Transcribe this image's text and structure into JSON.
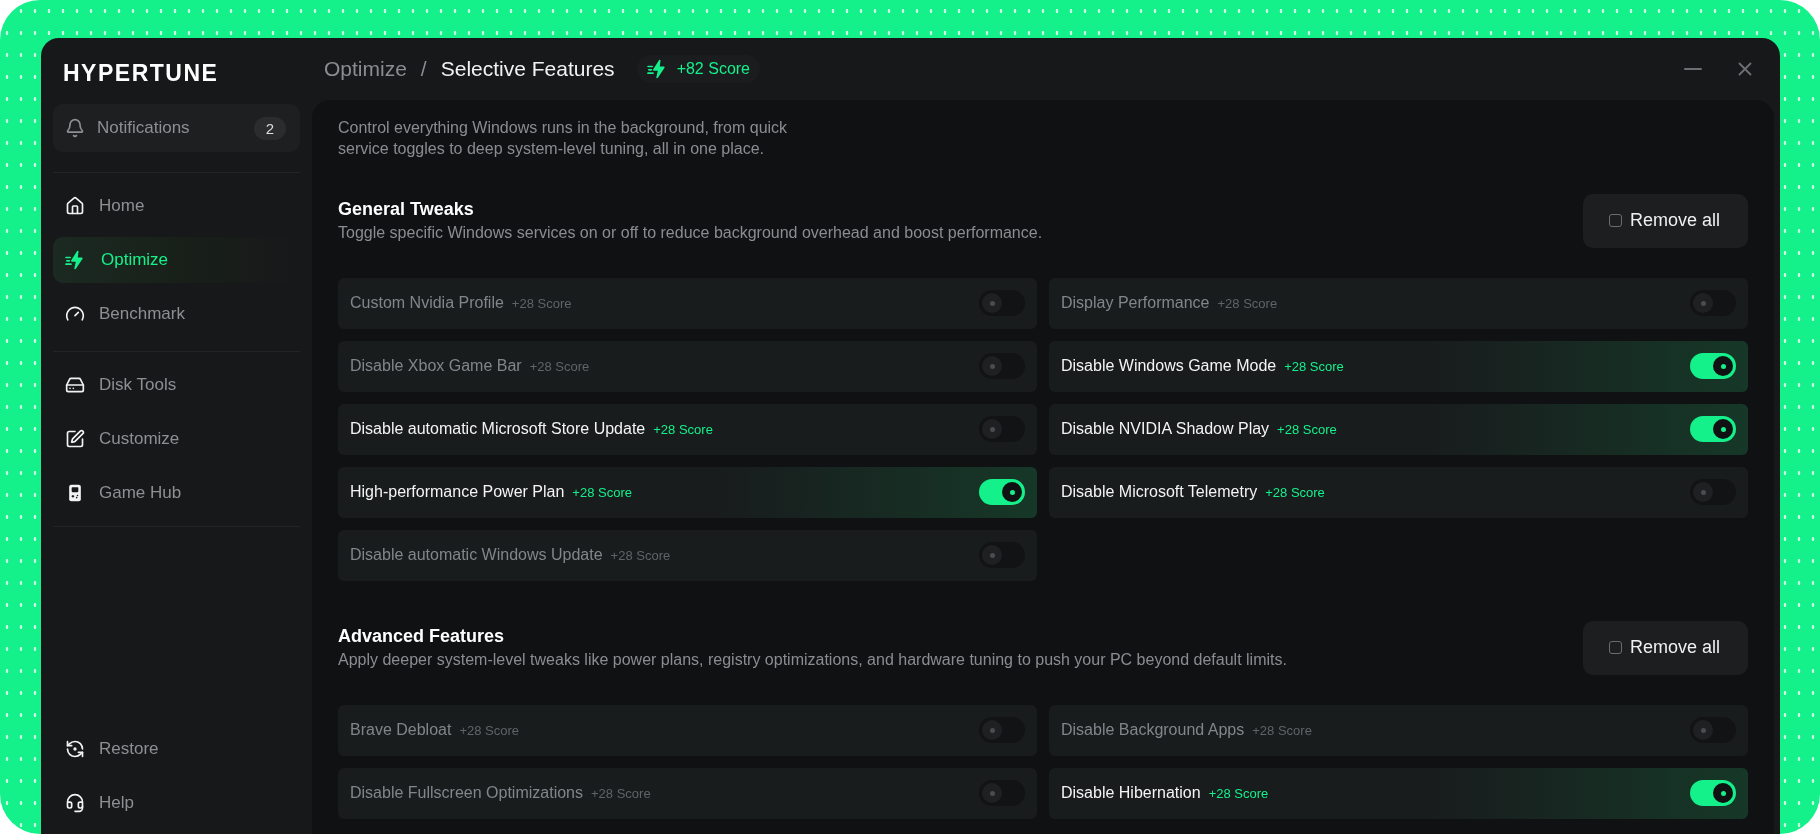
{
  "app": {
    "logo": "HYPERTUNE"
  },
  "sidebar": {
    "notifications": {
      "label": "Notifications",
      "count": "2"
    },
    "groups": [
      [
        {
          "label": "Home",
          "selected": false
        },
        {
          "label": "Optimize",
          "selected": true
        },
        {
          "label": "Benchmark",
          "selected": false
        }
      ],
      [
        {
          "label": "Disk Tools",
          "selected": false
        },
        {
          "label": "Customize",
          "selected": false
        },
        {
          "label": "Game Hub",
          "selected": false
        }
      ]
    ],
    "footer": [
      {
        "label": "Restore"
      },
      {
        "label": "Help"
      }
    ]
  },
  "header": {
    "breadcrumb": {
      "parent": "Optimize",
      "separator": "/",
      "current": "Selective Features"
    },
    "score": "+82 Score"
  },
  "content": {
    "intro": "Control everything Windows runs in the background, from quick service toggles to deep system-level tuning, all in one place.",
    "sections": [
      {
        "title": "General Tweaks",
        "description": "Toggle specific Windows services on or off to reduce background overhead and boost performance.",
        "button": {
          "label": "Remove all",
          "checked": false
        },
        "items": [
          {
            "label": "Custom Nvidia Profile",
            "score": "+28 Score",
            "on": false,
            "disabled": true
          },
          {
            "label": "Display Performance",
            "score": "+28 Score",
            "on": false,
            "disabled": true
          },
          {
            "label": "Disable Xbox Game Bar",
            "score": "+28 Score",
            "on": false,
            "disabled": true
          },
          {
            "label": "Disable Windows Game Mode",
            "score": "+28 Score",
            "on": true,
            "disabled": false
          },
          {
            "label": "Disable automatic Microsoft Store Update",
            "score": "+28 Score",
            "on": false,
            "disabled": false
          },
          {
            "label": "Disable NVIDIA Shadow Play",
            "score": "+28 Score",
            "on": true,
            "disabled": false
          },
          {
            "label": "High-performance Power Plan",
            "score": "+28 Score",
            "on": true,
            "disabled": false
          },
          {
            "label": "Disable Microsoft Telemetry",
            "score": "+28 Score",
            "on": false,
            "disabled": false
          },
          {
            "label": "Disable automatic Windows Update",
            "score": "+28 Score",
            "on": false,
            "disabled": true
          }
        ]
      },
      {
        "title": "Advanced Features",
        "description": "Apply deeper system-level tweaks like power plans, registry optimizations, and hardware tuning to push your PC beyond default limits.",
        "button": {
          "label": "Remove all",
          "checked": false
        },
        "items": [
          {
            "label": "Brave Debloat",
            "score": "+28 Score",
            "on": false,
            "disabled": true
          },
          {
            "label": "Disable Background Apps",
            "score": "+28 Score",
            "on": false,
            "disabled": true
          },
          {
            "label": "Disable Fullscreen Optimizations",
            "score": "+28 Score",
            "on": false,
            "disabled": true
          },
          {
            "label": "Disable Hibernation",
            "score": "+28 Score",
            "on": true,
            "disabled": false
          }
        ]
      }
    ]
  }
}
